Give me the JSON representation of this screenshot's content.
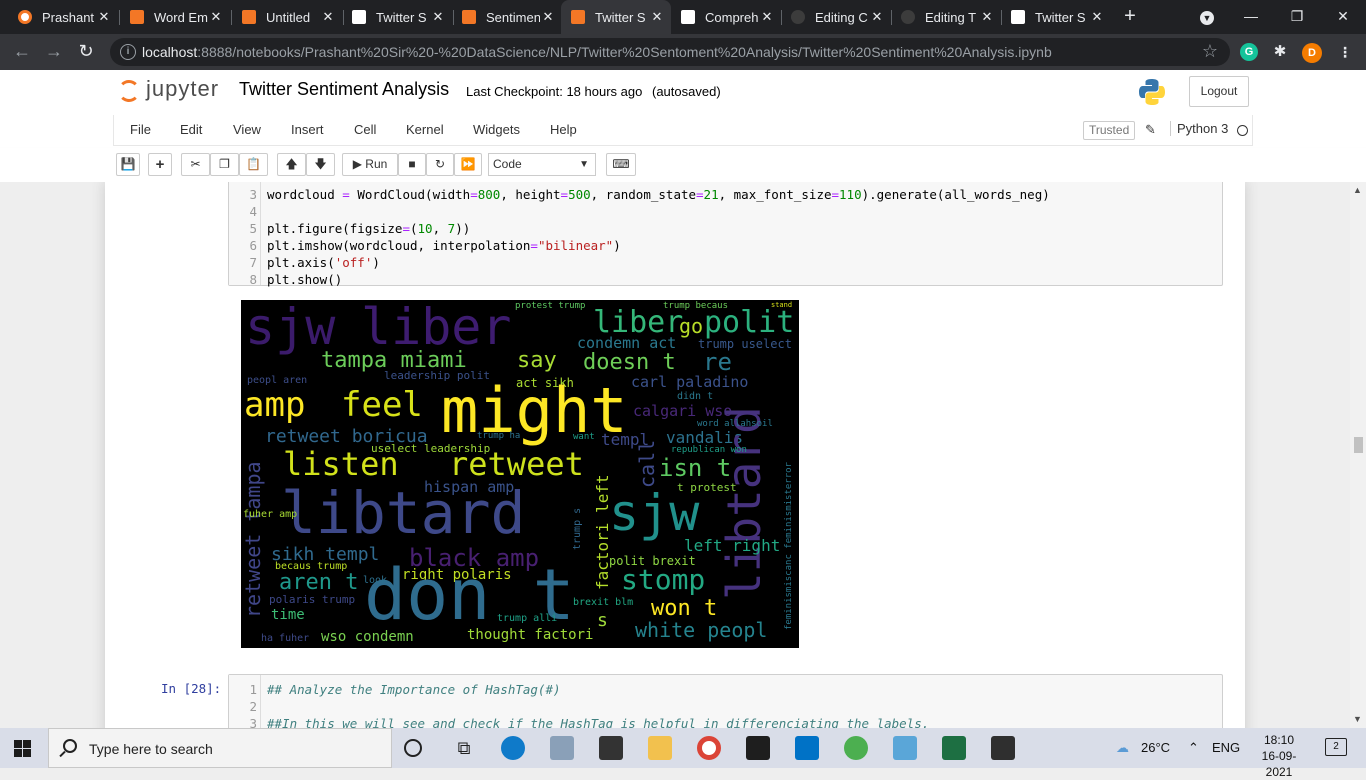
{
  "browser": {
    "tabs": [
      {
        "title": "Prashant",
        "icon": "chrome-icon",
        "color": "#e8eaed"
      },
      {
        "title": "Word Em",
        "icon": "jupyter-icon",
        "color": "#f37726"
      },
      {
        "title": "Untitled",
        "icon": "jupyter-icon",
        "color": "#f37726"
      },
      {
        "title": "Twitter S",
        "icon": "chart-icon",
        "color": "#ffffff"
      },
      {
        "title": "Sentimen",
        "icon": "jupyter-icon",
        "color": "#f37726"
      },
      {
        "title": "Twitter S",
        "icon": "jupyter-icon",
        "color": "#f37726"
      },
      {
        "title": "Compreh",
        "icon": "chart-icon",
        "color": "#ffffff"
      },
      {
        "title": "Editing C",
        "icon": "github-icon",
        "color": "#3c3c3c"
      },
      {
        "title": "Editing T",
        "icon": "github-icon",
        "color": "#3c3c3c"
      },
      {
        "title": "Twitter S",
        "icon": "chart-icon",
        "color": "#ffffff"
      }
    ],
    "active_tab": 5,
    "url_host": "localhost",
    "url_path": ":8888/notebooks/Prashant%20Sir%20-%20DataScience/NLP/Twitter%20Sentoment%20Analysis/Twitter%20Sentiment%20Analysis.ipynb",
    "extensions": [
      "G",
      "D"
    ]
  },
  "jupyter": {
    "logo_text": "jupyter",
    "notebook_name": "Twitter Sentiment Analysis",
    "checkpoint": "Last Checkpoint: 18 hours ago",
    "autosave": "(autosaved)",
    "logout": "Logout",
    "menu": [
      "File",
      "Edit",
      "View",
      "Insert",
      "Cell",
      "Kernel",
      "Widgets",
      "Help"
    ],
    "trusted": "Trusted",
    "kernel": "Python 3",
    "toolbar": {
      "run": "Run",
      "cell_type": "Code"
    }
  },
  "cell1": {
    "lines": [
      {
        "n": "3"
      },
      {
        "n": "4"
      },
      {
        "n": "5"
      },
      {
        "n": "6"
      },
      {
        "n": "7"
      },
      {
        "n": "8"
      }
    ]
  },
  "cell2": {
    "prompt": "In [28]:",
    "lines": [
      {
        "n": "1",
        "code": "## Analyze the Importance of HashTag(#)"
      },
      {
        "n": "2",
        "code": ""
      },
      {
        "n": "3",
        "code": "##In this we will see and check if the HashTag is helpful in differenciating the labels."
      }
    ]
  },
  "wordcloud_words": [
    {
      "t": "sjw",
      "c": "#3b1b6b"
    },
    {
      "t": "liber",
      "c": "#3e1c70"
    },
    {
      "t": "liber",
      "c": "#35b779"
    },
    {
      "t": "go",
      "c": "#b8de29"
    },
    {
      "t": "polit",
      "c": "#2cb17e"
    },
    {
      "t": "condemn act",
      "c": "#2a788e"
    },
    {
      "t": "trump uselect",
      "c": "#38588c"
    },
    {
      "t": "tampa miami",
      "c": "#6ccd5a"
    },
    {
      "t": "say",
      "c": "#a8db34"
    },
    {
      "t": "doesn t",
      "c": "#6ece58"
    },
    {
      "t": "re",
      "c": "#2a788e"
    },
    {
      "t": "carl paladino",
      "c": "#3b528b"
    },
    {
      "t": "act sikh",
      "c": "#aadc32"
    },
    {
      "t": "amp",
      "c": "#fde725"
    },
    {
      "t": "feel",
      "c": "#d8e219"
    },
    {
      "t": "might",
      "c": "#fde725"
    },
    {
      "t": "calgari wso",
      "c": "#482878"
    },
    {
      "t": "retweet boricua",
      "c": "#31688e"
    },
    {
      "t": "templ",
      "c": "#3e4a89"
    },
    {
      "t": "vandalis",
      "c": "#2c728e"
    },
    {
      "t": "listen",
      "c": "#d2e21b"
    },
    {
      "t": "retweet",
      "c": "#cde11d"
    },
    {
      "t": "isn t",
      "c": "#5ec962"
    },
    {
      "t": "hispan amp",
      "c": "#3a538b"
    },
    {
      "t": "t protest",
      "c": "#8fd744"
    },
    {
      "t": "libtard",
      "c": "#3e4989"
    },
    {
      "t": "sjw",
      "c": "#21918c"
    },
    {
      "t": "libtard",
      "c": "#46327e"
    },
    {
      "t": "left right",
      "c": "#22a884"
    },
    {
      "t": "black amp",
      "c": "#482071"
    },
    {
      "t": "sikh templ",
      "c": "#306a8e"
    },
    {
      "t": "right polaris",
      "c": "#c2df23"
    },
    {
      "t": "polit brexit",
      "c": "#8fd744"
    },
    {
      "t": "aren t",
      "c": "#1f988b"
    },
    {
      "t": "don t",
      "c": "#2f6c8e"
    },
    {
      "t": "stomp",
      "c": "#23a983"
    },
    {
      "t": "won t",
      "c": "#fde725"
    },
    {
      "t": "white peopl",
      "c": "#25838e"
    },
    {
      "t": "time",
      "c": "#3dbc74"
    },
    {
      "t": "wso condemn",
      "c": "#7ad151"
    },
    {
      "t": "thought factori",
      "c": "#a0da39"
    },
    {
      "t": "retweet tampa",
      "c": "#404688"
    },
    {
      "t": "factori left",
      "c": "#b5de2b"
    },
    {
      "t": "feminismiscanc feminismisterror",
      "c": "#2a788e"
    },
    {
      "t": "protest trump",
      "c": "#5ec962"
    },
    {
      "t": "trump becaus",
      "c": "#6ccd5a"
    },
    {
      "t": "brexit blm",
      "c": "#22a884"
    },
    {
      "t": "trump alli",
      "c": "#1fa187"
    },
    {
      "t": "polaris trump",
      "c": "#3e4989"
    },
    {
      "t": "word allahsoil",
      "c": "#2a788e"
    },
    {
      "t": "republican won",
      "c": "#1f9e89"
    },
    {
      "t": "didn t",
      "c": "#2a788e"
    },
    {
      "t": "trump ha",
      "c": "#2c728e"
    },
    {
      "t": "want",
      "c": "#1f9e89"
    },
    {
      "t": "uselect leadership",
      "c": "#9fda3a"
    },
    {
      "t": "leadership polit",
      "c": "#3b528b"
    },
    {
      "t": "peopl aren",
      "c": "#3d4e8a"
    },
    {
      "t": "becaus trump",
      "c": "#bddf26"
    },
    {
      "t": "fuher amp",
      "c": "#a8db34"
    },
    {
      "t": "ha fuher",
      "c": "#3e4a89"
    },
    {
      "t": "look",
      "c": "#2d708e"
    },
    {
      "t": "s",
      "c": "#9fda3a"
    },
    {
      "t": "stand",
      "c": "#d8e219"
    },
    {
      "t": "call",
      "c": "#3e4a89"
    },
    {
      "t": "trump s",
      "c": "#31688e"
    }
  ],
  "taskbar": {
    "search_placeholder": "Type here to search",
    "weather": "26°C",
    "language": "ENG",
    "time": "18:10",
    "date": "16-09-2021",
    "notifications": "2"
  }
}
